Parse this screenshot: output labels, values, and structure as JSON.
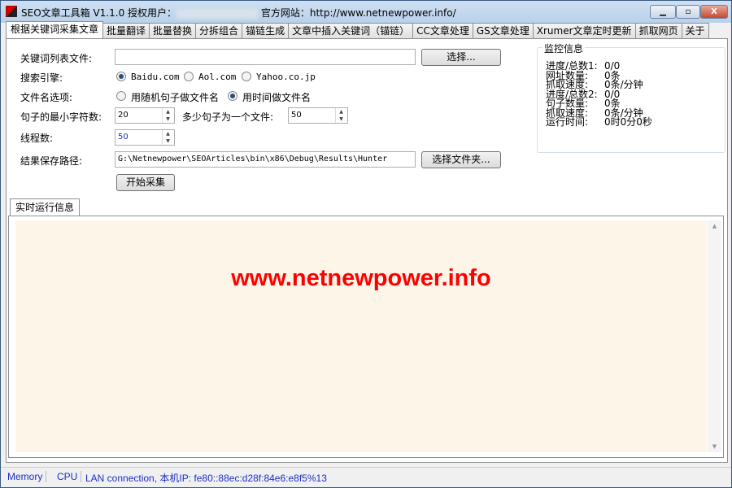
{
  "window": {
    "title_prefix": "SEO文章工具箱 V1.1.0 授权用户：",
    "title_suffix": "官方网站：http://www.netnewpower.info/",
    "minimize": "▁",
    "maximize": "▫",
    "close": "X"
  },
  "tabs": [
    "根据关键词采集文章",
    "批量翻译",
    "批量替换",
    "分拆组合",
    "锚链生成",
    "文章中插入关键词（锚链）",
    "CC文章处理",
    "GS文章处理",
    "Xrumer文章定时更新",
    "抓取网页",
    "关于"
  ],
  "form": {
    "keyword_file_label": "关键词列表文件:",
    "keyword_file_value": "",
    "select_button": "选择...",
    "engine_label": "搜索引擎:",
    "engines": [
      "Baidu.com",
      "Aol.com",
      "Yahoo.co.jp"
    ],
    "engine_selected": "Baidu.com",
    "filename_label": "文件名选项:",
    "filename_options": [
      "用随机句子做文件名",
      "用时间做文件名"
    ],
    "filename_selected": "用时间做文件名",
    "min_chars_label": "句子的最小字符数:",
    "min_chars_value": "20",
    "sentences_label": "多少句子为一个文件:",
    "sentences_value": "50",
    "threads_label": "线程数:",
    "threads_value": "50",
    "save_path_label": "结果保存路径:",
    "save_path_value": "G:\\Netnewpower\\SEOArticles\\bin\\x86\\Debug\\Results\\Hunter",
    "select_folder_button": "选择文件夹...",
    "start_button": "开始采集"
  },
  "monitor": {
    "title": "监控信息",
    "rows": [
      {
        "label": "进度/总数1:",
        "value": "0/0"
      },
      {
        "label": "网址数量:",
        "value": "0条"
      },
      {
        "label": "抓取速度:",
        "value": "0条/分钟"
      },
      {
        "label": "进度/总数2:",
        "value": "0/0"
      },
      {
        "label": "句子数量:",
        "value": "0条"
      },
      {
        "label": "抓取速度:",
        "value": "0条/分钟"
      },
      {
        "label": "运行时间:",
        "value": "0时0分0秒"
      }
    ]
  },
  "log": {
    "tab": "实时运行信息",
    "watermark": "www.netnewpower.info"
  },
  "status": {
    "memory": "Memory",
    "cpu": "CPU",
    "network": "LAN connection,  本机IP: fe80::88ec:d28f:84e6:e8f5%13"
  }
}
